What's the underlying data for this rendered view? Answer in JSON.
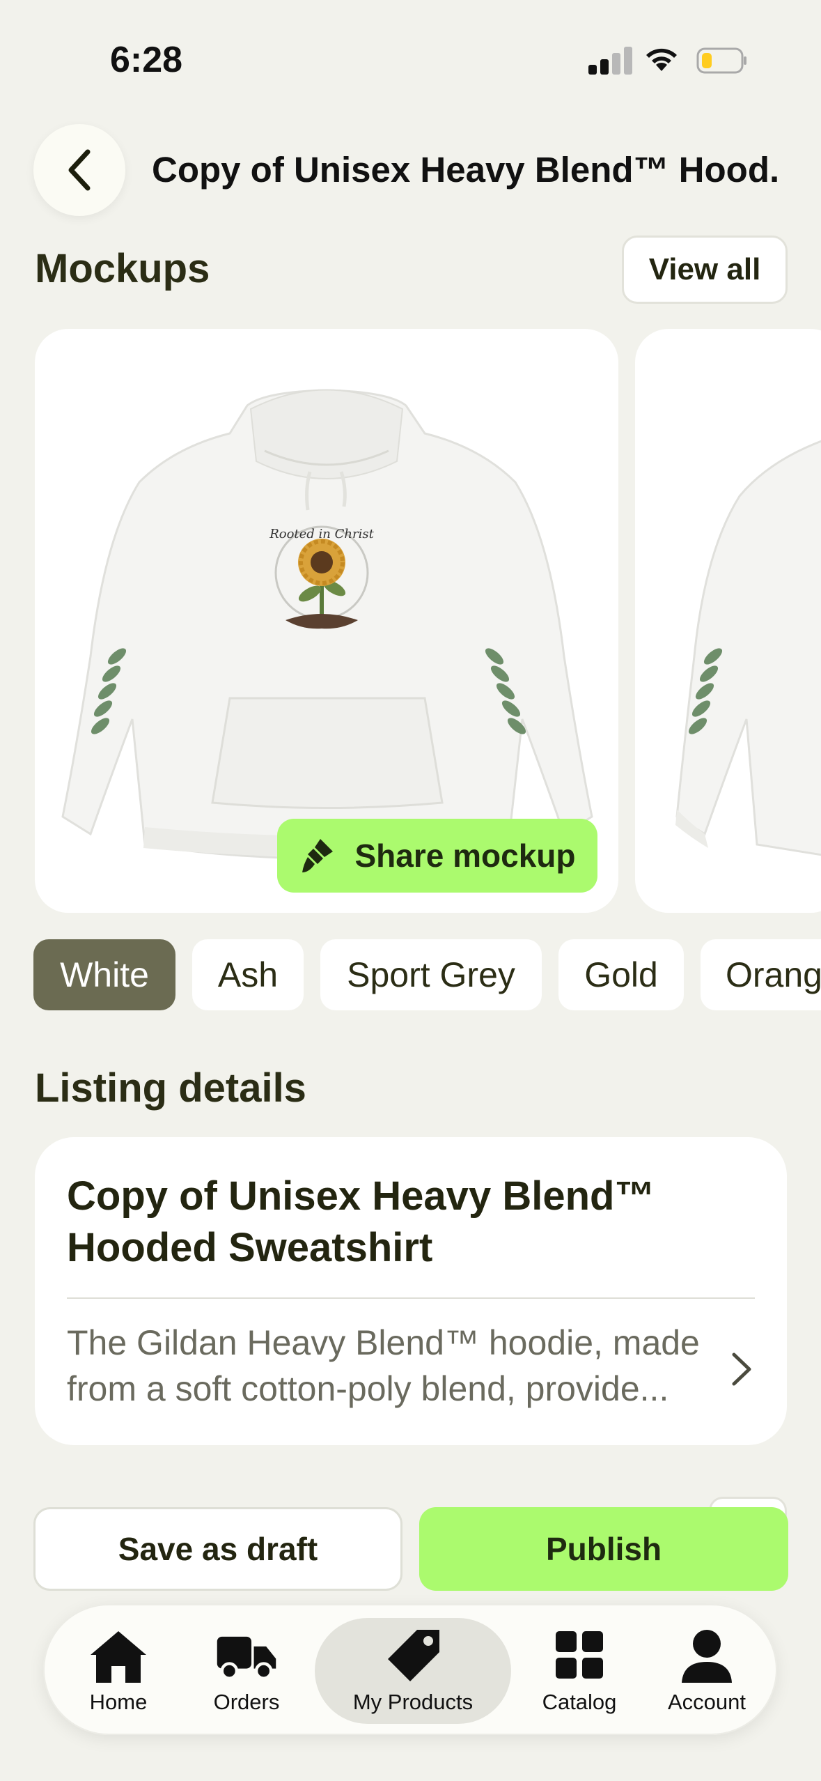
{
  "status_bar": {
    "time": "6:28"
  },
  "header": {
    "title": "Copy of Unisex Heavy Blend™ Hood..."
  },
  "mockups": {
    "section_title": "Mockups",
    "view_all_label": "View all",
    "design_text": "Rooted in Christ",
    "share_label": "Share mockup"
  },
  "colors": {
    "chips": [
      "White",
      "Ash",
      "Sport Grey",
      "Gold",
      "Orang"
    ],
    "selected": "White",
    "accent": "#abfa6e",
    "chip_active": "#6b6b52"
  },
  "listing": {
    "section_title": "Listing details",
    "name": "Copy of Unisex Heavy Blend™ Hooded Sweatshirt",
    "description": "The Gildan Heavy Blend™ hoodie, made from a soft cotton-poly blend, provide..."
  },
  "actions": {
    "save_draft_label": "Save as draft",
    "publish_label": "Publish"
  },
  "tabs": [
    {
      "label": "Home",
      "icon": "home-icon"
    },
    {
      "label": "Orders",
      "icon": "truck-icon"
    },
    {
      "label": "My Products",
      "icon": "tag-icon"
    },
    {
      "label": "Catalog",
      "icon": "grid-icon"
    },
    {
      "label": "Account",
      "icon": "person-icon"
    }
  ],
  "active_tab": "My Products"
}
